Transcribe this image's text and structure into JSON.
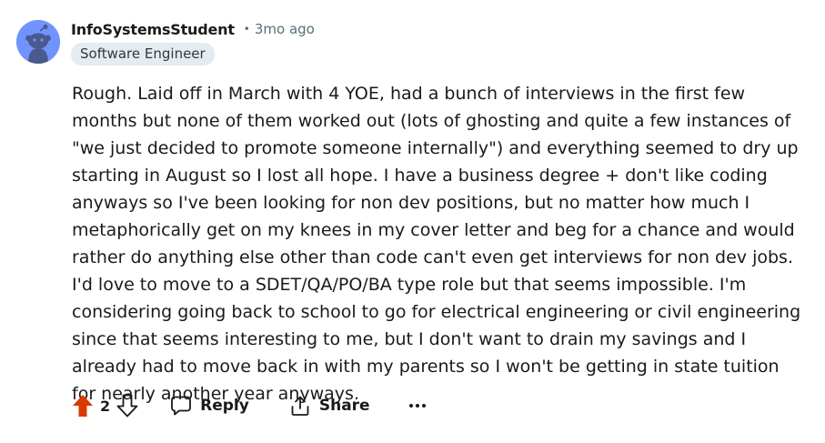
{
  "comment": {
    "username": "InfoSystemsStudent",
    "separator": "•",
    "timestamp": "3mo ago",
    "flair": "Software Engineer",
    "body": "Rough. Laid off in March with 4 YOE, had a bunch of interviews in the first few months but none of them worked out (lots of ghosting and quite a few instances of \"we just decided to promote someone internally\") and everything seemed to dry up starting in August so I lost all hope. I have a business degree + don't like coding anyways so I've been looking for non dev positions, but no matter how much I metaphorically get on my knees in my cover letter and beg for a chance and would rather do anything else other than code can't even get interviews for non dev jobs. I'd love to move to a SDET/QA/PO/BA type role but that seems impossible. I'm considering going back to school to go for electrical engineering or civil engineering since that seems interesting to me, but I don't want to drain my savings and I already had to move back in with my parents so I won't be getting in state tuition for nearly another year anyways."
  },
  "actions": {
    "score": "2",
    "reply_label": "Reply",
    "share_label": "Share",
    "more_label": "•••",
    "upvoted": true
  },
  "colors": {
    "upvote_active": "#d93900",
    "avatar_bg": "#7193ff",
    "flair_bg": "#e5ebee",
    "meta_text": "#576f76"
  },
  "icons": {
    "avatar": "snoo-avatar-icon",
    "upvote": "upvote-arrow-icon",
    "downvote": "downvote-arrow-icon",
    "reply": "comment-bubble-icon",
    "share": "share-icon",
    "more": "overflow-dots-icon"
  }
}
